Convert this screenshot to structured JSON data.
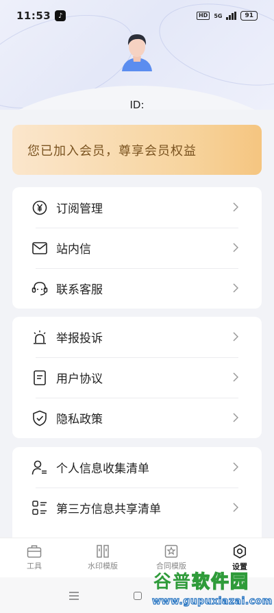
{
  "status_bar": {
    "time": "11:53",
    "battery": "91",
    "network": "5G",
    "hd": "HD"
  },
  "profile": {
    "id_label": "ID:"
  },
  "banner": {
    "text": "您已加入会员，尊享会员权益"
  },
  "menu_groups": [
    {
      "items": [
        {
          "label": "订阅管理",
          "icon": "yen-circle-icon"
        },
        {
          "label": "站内信",
          "icon": "mail-icon"
        },
        {
          "label": "联系客服",
          "icon": "headset-icon"
        }
      ]
    },
    {
      "items": [
        {
          "label": "举报投诉",
          "icon": "alarm-icon"
        },
        {
          "label": "用户协议",
          "icon": "document-icon"
        },
        {
          "label": "隐私政策",
          "icon": "shield-check-icon"
        }
      ]
    },
    {
      "items": [
        {
          "label": "个人信息收集清单",
          "icon": "user-list-icon"
        },
        {
          "label": "第三方信息共享清单",
          "icon": "grid-list-icon"
        }
      ]
    }
  ],
  "tabs": [
    {
      "label": "工具",
      "icon": "toolbox-icon",
      "active": false
    },
    {
      "label": "水印模版",
      "icon": "watermark-template-icon",
      "active": false
    },
    {
      "label": "合同模版",
      "icon": "contract-template-icon",
      "active": false
    },
    {
      "label": "设置",
      "icon": "settings-icon",
      "active": true
    }
  ],
  "watermark": {
    "main_green": "谷普",
    "main_rest": "软件园",
    "url": "www.gupuxiazai.com"
  },
  "colors": {
    "banner_text": "#7a5320",
    "banner_start": "#fbe6cc",
    "banner_end": "#f5c580",
    "watermark_green": "#2f9b3a",
    "watermark_blue": "#1f6fbf"
  }
}
